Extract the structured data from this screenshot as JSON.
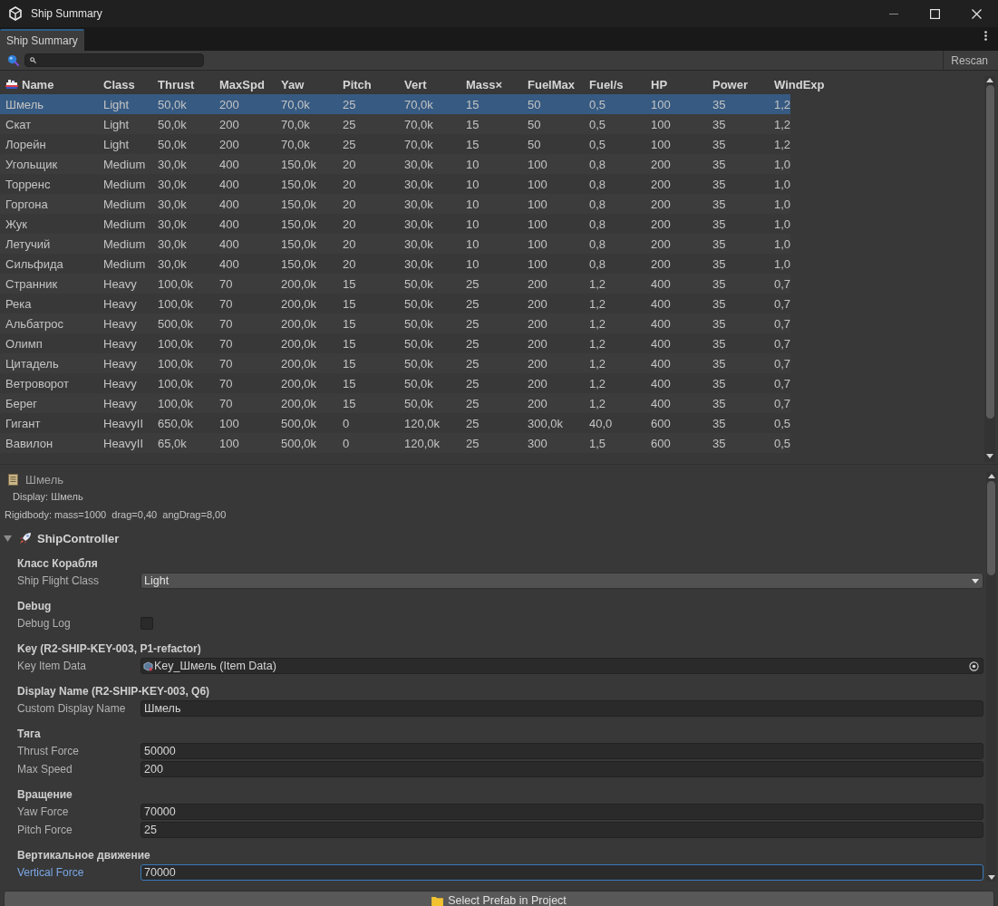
{
  "window": {
    "title": "Ship Summary"
  },
  "tabs": [
    {
      "label": "Ship Summary",
      "selected": true
    }
  ],
  "toolbar": {
    "rescan_button": "Rescan"
  },
  "table": {
    "columns": [
      "Name",
      "Class",
      "Thrust",
      "MaxSpd",
      "Yaw",
      "Pitch",
      "Vert",
      "Mass×",
      "FuelMax",
      "Fuel/s",
      "HP",
      "Power",
      "WindExp"
    ],
    "rows": [
      {
        "selected": true,
        "cells": [
          "Шмель",
          "Light",
          "50,0k",
          "200",
          "70,0k",
          "25",
          "70,0k",
          "15",
          "50",
          "0,5",
          "100",
          "35",
          "1,2"
        ]
      },
      {
        "selected": false,
        "cells": [
          "Скат",
          "Light",
          "50,0k",
          "200",
          "70,0k",
          "25",
          "70,0k",
          "15",
          "50",
          "0,5",
          "100",
          "35",
          "1,2"
        ]
      },
      {
        "selected": false,
        "cells": [
          "Лорейн",
          "Light",
          "50,0k",
          "200",
          "70,0k",
          "25",
          "70,0k",
          "15",
          "50",
          "0,5",
          "100",
          "35",
          "1,2"
        ]
      },
      {
        "selected": false,
        "cells": [
          "Угольщик",
          "Medium",
          "30,0k",
          "400",
          "150,0k",
          "20",
          "30,0k",
          "10",
          "100",
          "0,8",
          "200",
          "35",
          "1,0"
        ]
      },
      {
        "selected": false,
        "cells": [
          "Торренс",
          "Medium",
          "30,0k",
          "400",
          "150,0k",
          "20",
          "30,0k",
          "10",
          "100",
          "0,8",
          "200",
          "35",
          "1,0"
        ]
      },
      {
        "selected": false,
        "cells": [
          "Горгона",
          "Medium",
          "30,0k",
          "400",
          "150,0k",
          "20",
          "30,0k",
          "10",
          "100",
          "0,8",
          "200",
          "35",
          "1,0"
        ]
      },
      {
        "selected": false,
        "cells": [
          "Жук",
          "Medium",
          "30,0k",
          "400",
          "150,0k",
          "20",
          "30,0k",
          "10",
          "100",
          "0,8",
          "200",
          "35",
          "1,0"
        ]
      },
      {
        "selected": false,
        "cells": [
          "Летучий",
          "Medium",
          "30,0k",
          "400",
          "150,0k",
          "20",
          "30,0k",
          "10",
          "100",
          "0,8",
          "200",
          "35",
          "1,0"
        ]
      },
      {
        "selected": false,
        "cells": [
          "Сильфида",
          "Medium",
          "30,0k",
          "400",
          "150,0k",
          "20",
          "30,0k",
          "10",
          "100",
          "0,8",
          "200",
          "35",
          "1,0"
        ]
      },
      {
        "selected": false,
        "cells": [
          "Странник",
          "Heavy",
          "100,0k",
          "70",
          "200,0k",
          "15",
          "50,0k",
          "25",
          "200",
          "1,2",
          "400",
          "35",
          "0,7"
        ]
      },
      {
        "selected": false,
        "cells": [
          "Река",
          "Heavy",
          "100,0k",
          "70",
          "200,0k",
          "15",
          "50,0k",
          "25",
          "200",
          "1,2",
          "400",
          "35",
          "0,7"
        ]
      },
      {
        "selected": false,
        "cells": [
          "Альбатрос",
          "Heavy",
          "500,0k",
          "70",
          "200,0k",
          "15",
          "50,0k",
          "25",
          "200",
          "1,2",
          "400",
          "35",
          "0,7"
        ]
      },
      {
        "selected": false,
        "cells": [
          "Олимп",
          "Heavy",
          "100,0k",
          "70",
          "200,0k",
          "15",
          "50,0k",
          "25",
          "200",
          "1,2",
          "400",
          "35",
          "0,7"
        ]
      },
      {
        "selected": false,
        "cells": [
          "Цитадель",
          "Heavy",
          "100,0k",
          "70",
          "200,0k",
          "15",
          "50,0k",
          "25",
          "200",
          "1,2",
          "400",
          "35",
          "0,7"
        ]
      },
      {
        "selected": false,
        "cells": [
          "Ветроворот",
          "Heavy",
          "100,0k",
          "70",
          "200,0k",
          "15",
          "50,0k",
          "25",
          "200",
          "1,2",
          "400",
          "35",
          "0,7"
        ]
      },
      {
        "selected": false,
        "cells": [
          "Берег",
          "Heavy",
          "100,0k",
          "70",
          "200,0k",
          "15",
          "50,0k",
          "25",
          "200",
          "1,2",
          "400",
          "35",
          "0,7"
        ]
      },
      {
        "selected": false,
        "cells": [
          "Гигант",
          "HeavyII",
          "650,0k",
          "100",
          "500,0k",
          "0",
          "120,0k",
          "25",
          "300,0k",
          "40,0",
          "600",
          "35",
          "0,5"
        ]
      },
      {
        "selected": false,
        "cells": [
          "Вавилон",
          "HeavyII",
          "65,0k",
          "100",
          "500,0k",
          "0",
          "120,0k",
          "25",
          "300",
          "1,5",
          "600",
          "35",
          "0,5"
        ]
      }
    ]
  },
  "inspector": {
    "title": "Шмель",
    "display": "Display: Шмель",
    "rigidbody": "Rigidbody: mass=1000  drag=0,40  angDrag=8,00",
    "component": {
      "name": "ShipController",
      "expanded": true,
      "sections": [
        {
          "heading": "Класс Корабля",
          "fields": [
            {
              "kind": "dropdown",
              "label": "Ship Flight Class",
              "value": "Light",
              "focused": false
            }
          ]
        },
        {
          "heading": "Debug",
          "fields": [
            {
              "kind": "checkbox",
              "label": "Debug Log",
              "checked": false,
              "focused": false
            }
          ]
        },
        {
          "heading": "Key (R2-SHIP-KEY-003, P1-refactor)",
          "fields": [
            {
              "kind": "object",
              "label": "Key Item Data",
              "value": "Key_Шмель (Item Data)",
              "focused": false
            }
          ]
        },
        {
          "heading": "Display Name (R2-SHIP-KEY-003, Q6)",
          "fields": [
            {
              "kind": "text",
              "label": "Custom Display Name",
              "value": "Шмель",
              "focused": false
            }
          ]
        },
        {
          "heading": "Тяга",
          "fields": [
            {
              "kind": "text",
              "label": "Thrust Force",
              "value": "50000",
              "focused": false
            },
            {
              "kind": "text",
              "label": "Max Speed",
              "value": "200",
              "focused": false
            }
          ]
        },
        {
          "heading": "Вращение",
          "fields": [
            {
              "kind": "text",
              "label": "Yaw Force",
              "value": "70000",
              "focused": false
            },
            {
              "kind": "text",
              "label": "Pitch Force",
              "value": "25",
              "focused": false
            }
          ]
        },
        {
          "heading": "Вертикальное движение",
          "fields": [
            {
              "kind": "text",
              "label": "Vertical Force",
              "value": "70000",
              "focused": true
            }
          ]
        }
      ]
    }
  },
  "footer": {
    "button": "Select Prefab in Project"
  }
}
